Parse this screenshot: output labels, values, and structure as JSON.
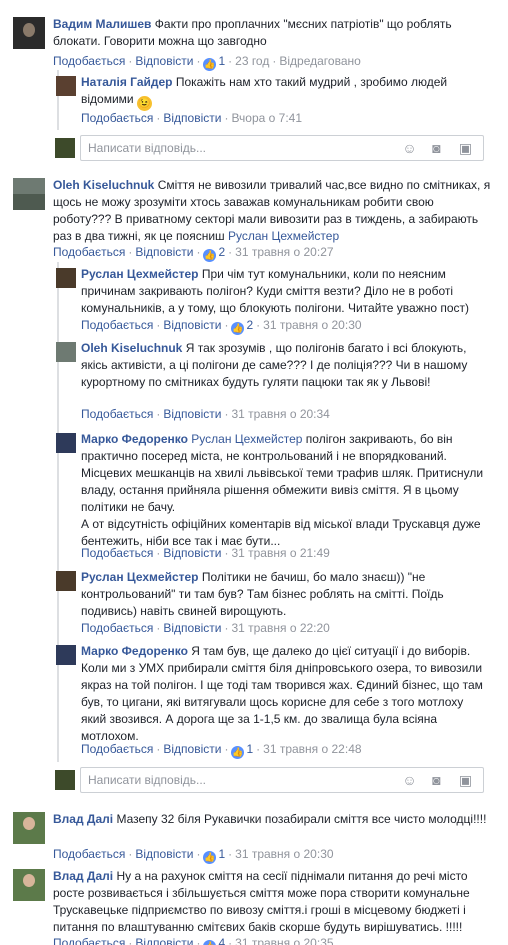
{
  "actions": {
    "like": "Подобається",
    "reply": "Відповісти",
    "sep": "·"
  },
  "composer_placeholder": "Написати відповідь...",
  "comments": [
    {
      "name": "Вадим Малишев",
      "text": "Факти про проплачних \"мєсних патріотів\" що роблять блокати. Говорити можна що завгодно",
      "likes": "1",
      "time": "23 год",
      "edited": "Відредаговано"
    },
    {
      "name": "Наталія Гайдер",
      "text": "Покажіть нам хто такий мудрий , зробимо людей відомими",
      "time": "Вчора о 7:41"
    },
    {
      "name": "Oleh Kiseluchnuk",
      "text": "Сміття не вивозили тривалий час,все видно по смітниках, я щось не можу зрозуміти хтось заважав комунальникам робити свою роботу??? В приватному секторі мали вивозити раз в тиждень, а забирають раз в два тижні, як це поясниш",
      "tag": "Руслан Цехмейстер",
      "likes": "2",
      "time": "31 травня о 20:27"
    },
    {
      "name": "Руслан Цехмейстер",
      "text": "При чім тут комунальники, коли по неясним причинам закривають полігон? Куди сміття везти? Діло не в роботі комунальників, а у тому, що блокують полігони. Читайте уважно пост)",
      "likes": "2",
      "time": "31 травня о 20:30"
    },
    {
      "name": "Oleh Kiseluchnuk",
      "text": "Я так зрозумів , що полігонів багато і всі блокують, якісь активісти, а ці полігони де саме??? І де поліція??? Чи в нашому курортному по смітниках будуть гуляти пацюки так як у Львові!",
      "time": "31 травня о 20:34"
    },
    {
      "name": "Марко Федоренко",
      "tag": "Руслан Цехмейстер",
      "text": "полігон закривають, бо він практично посеред міста, не контрольований і не впорядкований. Місцевих мешканців на хвилі львівської теми трафив шляк. Притиснули владу, остання прийняла рішення обмежити вивіз сміття. Я в цьому політики не бачу.",
      "text2": "А от відсутність офіційних коментарів від міської влади Трускавця дуже бентежить, ніби все так і має бути...",
      "time": "31 травня о 21:49"
    },
    {
      "name": "Руслан Цехмейстер",
      "text": "Політики не бачиш, бо мало знаєш)) \"не контрольований\" ти там був? Там бізнес роблять на смітті. Поїдь подивись) навіть свиней вирощують.",
      "time": "31 травня о 22:20"
    },
    {
      "name": "Марко Федоренко",
      "text": "Я там був, ще далеко до цієї ситуації і до виборів. Коли ми з УМХ прибирали сміття біля дніпровського озера, то вивозили якраз на той полігон. І ще тоді там творився жах. Єдиний бізнес, що там був, то цигани, які витягували щось корисне для себе з того мотлоху який звозився. А дорога ще за 1-1,5 км. до звалища була всіяна мотлохом.",
      "likes": "1",
      "time": "31 травня о 22:48"
    },
    {
      "name": "Влад Далі",
      "text": "Мазепу 32 біля Рукавички позабирали сміття все чисто молодці!!!!",
      "likes": "1",
      "time": "31 травня о 20:30"
    },
    {
      "name": "Влад Далі",
      "text": "Ну а на рахунок сміття на сесії піднімали питання до речі місто росте розвивається і збільшується сміття може пора створити комунальне Трускавецьке підприємство по вивозу сміття.і гроші в місцевому бюджеті і питання по влаштуванню смітєвих баків скорше будуть вирішуватись. !!!!!",
      "likes": "4",
      "time": "31 травня о 20:35"
    }
  ]
}
